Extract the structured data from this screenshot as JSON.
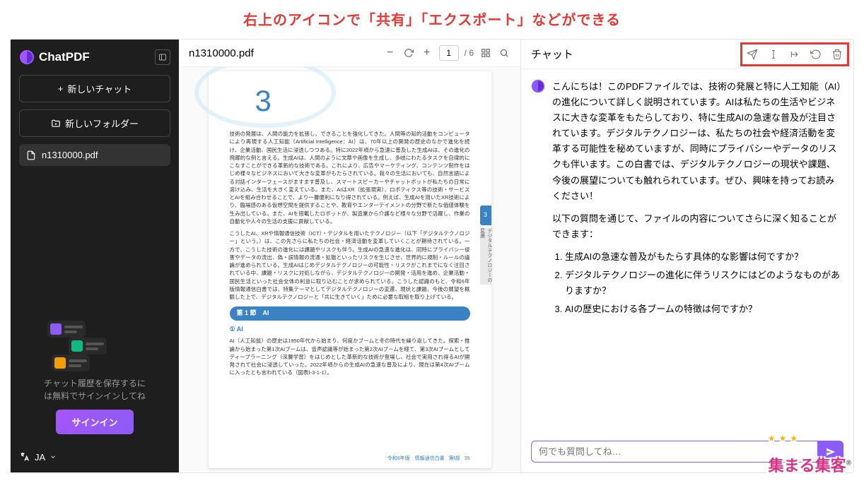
{
  "annotation": "右上のアイコンで「共有」「エクスポート」などができる",
  "brand": {
    "name": "ChatPDF"
  },
  "sidebar": {
    "new_chat": "新しいチャット",
    "new_folder": "新しいフォルダー",
    "file_name": "n1310000.pdf",
    "history_line1": "チャット履歴を保存するに",
    "history_line2": "は無料でサインインしてね",
    "signin": "サインイン",
    "lang_label": "JA"
  },
  "pdf": {
    "filename": "n1310000.pdf",
    "current_page": "1",
    "total_pages": "/ 6",
    "big_number": "3",
    "side_tab": "3",
    "side_tab2": "デジタルテクノロジーの変遷",
    "para1": "技術の発展は、人間の能力を拡張し、できることを強化してきた。人間等の知的活動をコンピュータにより再現する人工知能（Artificial Intelligence：AI）は、70年以上の開発の歴史のなかで進化を続け、企業活動、国民生活に浸透しつつある。特に2022年頃から急速に普及した生成AIは、その進化の飛躍的な例と言える。生成AIは、人間のように文章や画像を生成し、多岐にわたるタスクを自律的にこなすことができる革新的な技術である。これにより、広告やマーケティング、コンテンツ制作をはじめ様々なビジネスにおいて大きな変革がもたらされている。我々の生活においても、自然言語による対話インターフェースがますます普及し、スマートスピーカーやチャットボットが私たちの日常に溶け込み、生活を大きく変えている。また、AIはXR（拡張現実）、ロボティクス等の技術・サービスとAIを組み合わせることで、より一層便利になり得されている。例えば、生成AIを用いたXR技術により、臨場感のある仮想空間を提供することや、教育やエンターテイメントの分野で新たな価値体験を生み出している。また、AIを搭載したロボットが、製造業から介護など様々な分野で活躍し、作業の自動化や人々の生活の支援に貢献している。",
    "para2": "こうしたAI、XRや情報通信技術（ICT）・デジタルを用いたテクノロジー（以下「デジタルテクノロジー」という。）は、この先さらに私たちの社会・経済活動を変革していくことが期待されている。一方で、こうした技術の進化には課題やリスクも伴う。生成AIの急速な進化は、同時にプライバシー侵害やデータの流出、偽・誤情報の流通・拡散といったリスクを生じさせ、世界的に規制・ルールの議論が進められている。生成AIはじめデジタルテクノロジーの可能性・リスクがこれまでになく注目されている中、課題・リスクに対処しながら、デジタルテクノロジーの開発・活用を進め、企業活動・国民生活といった社会全体の利益に取り込むことが求められている。こうした認識のもと、令和6年版情報通信白書では、特集テーマとしてデジタルテクノロジーの変遷、現状と課題、今後の展望を概観した上で、デジタルテクノロジーと「共に生きていく」ために必要な取組を取り上げている。",
    "section_bar": "第 1 節　AI",
    "section_sub": "① AI",
    "para3": "AI（人工知能）の歴史は1950年代から始まり、何度かブームと冬の時代を繰り返してきた。探索・推論から始まった第1次AIブームは、音声認識等が始まった第2次AIブームを経て、第3次AIブームとしてディープラーニング（深層学習）をはじめとした革新的な技術が登場し、社会で実用され得るAIが開発されて社会に浸透していった。2022年頃からの生成AIの急速な普及により、現在は第4次AIブームに入ったとも言われている（図表Ⅰ-3-1-1）。",
    "footer1": "令和6年版　情報通信白書",
    "footer2": "第Ⅰ部",
    "footer3": "35"
  },
  "chat": {
    "title": "チャット",
    "greeting": "こんにちは！このPDFファイルでは、技術の発展と特に人工知能（AI）の進化について詳しく説明されています。AIは私たちの生活やビジネスに大きな変革をもたらしており、特に生成AIの急速な普及が注目されています。デジタルテクノロジーは、私たちの社会や経済活動を変革する可能性を秘めていますが、同時にプライバシーやデータのリスクも伴います。この白書では、デジタルテクノロジーの現状や課題、今後の展望についても触れられています。ぜひ、興味を持ってお読みください！",
    "followup": "以下の質問を通じて、ファイルの内容についてさらに深く知ることができます：",
    "q1": "生成AIの急速な普及がもたらす具体的な影響は何ですか？",
    "q2": "デジタルテクノロジーの進化に伴うリスクにはどのようなものがありますか？",
    "q3": "AIの歴史における各ブームの特徴は何ですか？",
    "placeholder": "何でも質問してね…"
  },
  "watermark": {
    "text": "集まる集客"
  }
}
